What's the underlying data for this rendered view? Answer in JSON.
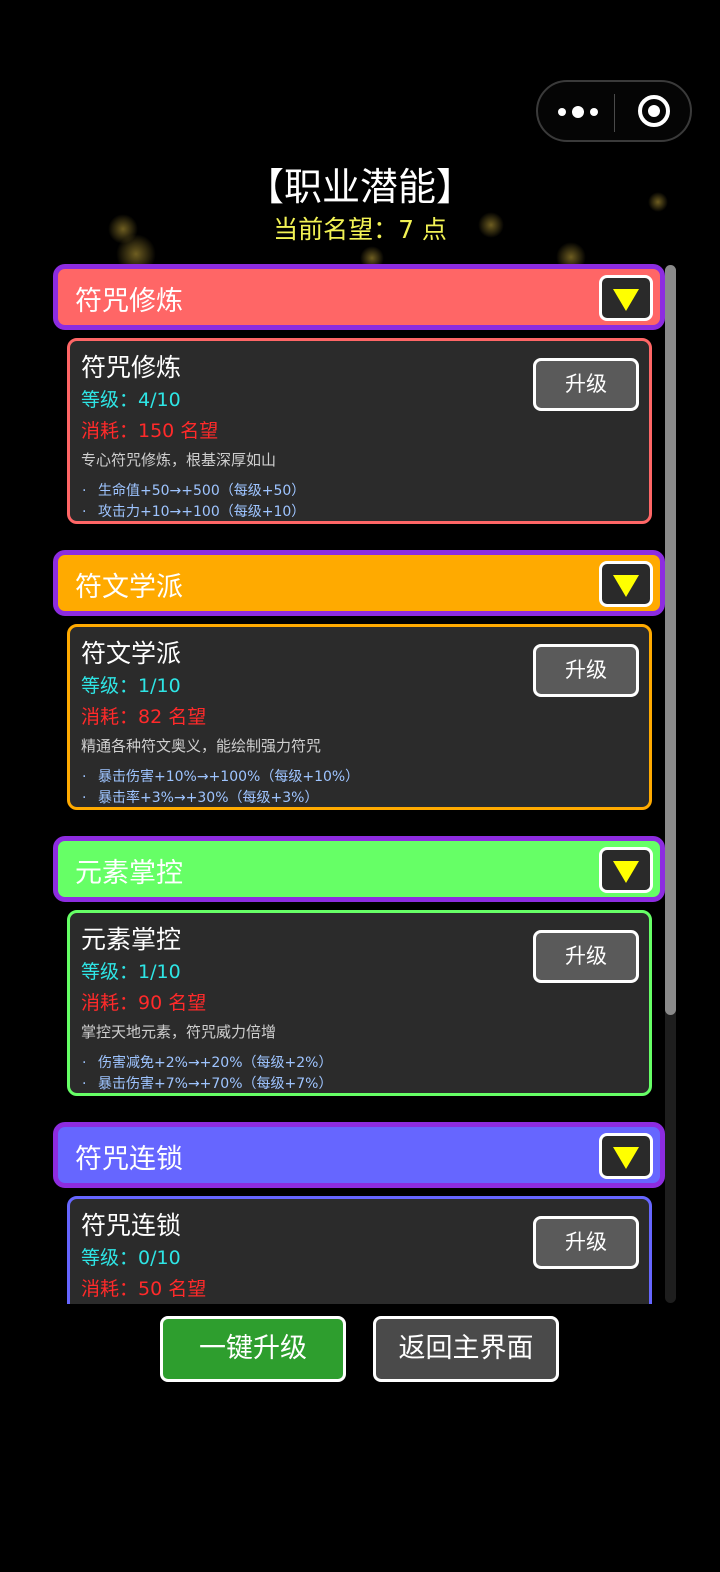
{
  "header": {
    "title": "【职业潜能】",
    "reputation": "当前名望：7 点"
  },
  "capsule": {
    "more_icon": "more-dots-icon",
    "close_icon": "target-icon"
  },
  "sections": [
    {
      "title": "符咒修炼",
      "header_color": "#ff6666",
      "border_color": "#ff6666",
      "card": {
        "name": "符咒修炼",
        "level": "等级：4/10",
        "cost": "消耗：150 名望",
        "desc": "专心符咒修炼，根基深厚如山",
        "bonuses": [
          "生命值+50→+500（每级+50）",
          "攻击力+10→+100（每级+10）"
        ],
        "button": "升级"
      }
    },
    {
      "title": "符文学派",
      "header_color": "#ffaa00",
      "border_color": "#ffaa00",
      "card": {
        "name": "符文学派",
        "level": "等级：1/10",
        "cost": "消耗：82 名望",
        "desc": "精通各种符文奥义，能绘制强力符咒",
        "bonuses": [
          "暴击伤害+10%→+100%（每级+10%）",
          "暴击率+3%→+30%（每级+3%）"
        ],
        "button": "升级"
      }
    },
    {
      "title": "元素掌控",
      "header_color": "#66ff66",
      "border_color": "#66ff66",
      "card": {
        "name": "元素掌控",
        "level": "等级：1/10",
        "cost": "消耗：90 名望",
        "desc": "掌控天地元素，符咒威力倍增",
        "bonuses": [
          "伤害减免+2%→+20%（每级+2%）",
          "暴击伤害+7%→+70%（每级+7%）"
        ],
        "button": "升级"
      }
    },
    {
      "title": "符咒连锁",
      "header_color": "#6666ff",
      "border_color": "#6666ff",
      "card": {
        "name": "符咒连锁",
        "level": "等级：0/10",
        "cost": "消耗：50 名望",
        "desc": "",
        "bonuses": [],
        "button": "升级"
      }
    }
  ],
  "footer": {
    "upgrade_all": "一键升级",
    "back_main": "返回主界面",
    "upgrade_all_color": "#2e9e2e",
    "back_color": "#4a4a4a"
  },
  "colors": {
    "section_outline": "#8d2ce0",
    "title": "#ffffff",
    "reputation": "#f2f254",
    "level": "#2ee5e5",
    "cost": "#ff2a2a",
    "bonus": "#9ec4ff"
  }
}
